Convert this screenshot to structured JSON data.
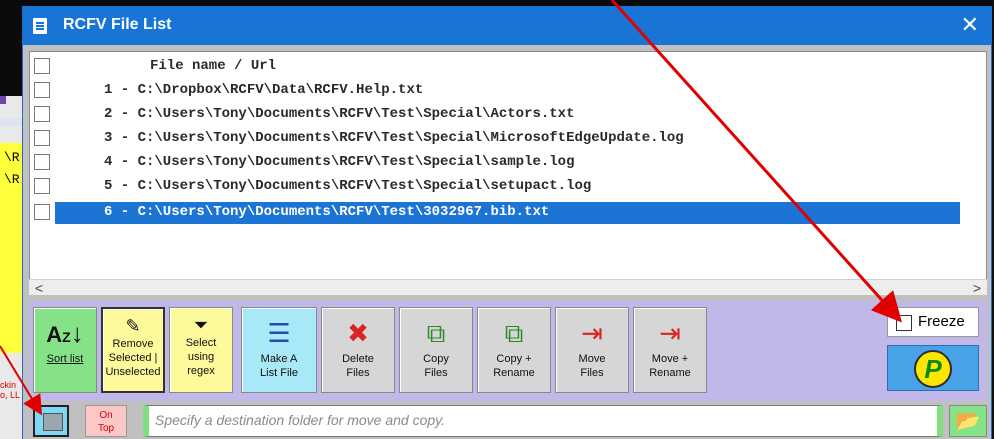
{
  "window": {
    "title": "RCFV File List",
    "close_glyph": "✕"
  },
  "background": {
    "yellow_lines": [
      "\\R",
      "\\R"
    ],
    "red_lines": [
      "ckin",
      "o, LL"
    ]
  },
  "list": {
    "header": "File name / Url",
    "rows": [
      {
        "text": "1 - C:\\Dropbox\\RCFV\\Data\\RCFV.Help.txt",
        "selected": false
      },
      {
        "text": "2 - C:\\Users\\Tony\\Documents\\RCFV\\Test\\Special\\Actors.txt",
        "selected": false
      },
      {
        "text": "3 - C:\\Users\\Tony\\Documents\\RCFV\\Test\\Special\\MicrosoftEdgeUpdate.log",
        "selected": false
      },
      {
        "text": "4 - C:\\Users\\Tony\\Documents\\RCFV\\Test\\Special\\sample.log",
        "selected": false
      },
      {
        "text": "5 - C:\\Users\\Tony\\Documents\\RCFV\\Test\\Special\\setupact.log",
        "selected": false
      },
      {
        "text": "6 - C:\\Users\\Tony\\Documents\\RCFV\\Test\\3032967.bib.txt",
        "selected": true
      }
    ],
    "scroll_left": "<",
    "scroll_right": ">"
  },
  "toolbar": {
    "sort": {
      "label": "Sort list",
      "icon": "sort-az-icon"
    },
    "remove": {
      "line1": "Remove",
      "line2": "Selected |",
      "line3": "Unselected",
      "icon": "eraser-icon"
    },
    "select": {
      "line1": "Select",
      "line2": "using",
      "line3": "regex",
      "icon": "funnel-icon"
    },
    "makelist": {
      "line1": "Make A",
      "line2": "List File",
      "icon": "list-file-icon"
    },
    "delete": {
      "line1": "Delete",
      "line2": "Files",
      "icon": "delete-files-icon"
    },
    "copy": {
      "line1": "Copy",
      "line2": "Files",
      "icon": "copy-files-icon"
    },
    "copyrename": {
      "line1": "Copy +",
      "line2": "Rename",
      "icon": "copy-rename-icon"
    },
    "move": {
      "line1": "Move",
      "line2": "Files",
      "icon": "move-files-icon"
    },
    "moverename": {
      "line1": "Move +",
      "line2": "Rename",
      "icon": "move-rename-icon"
    },
    "freeze_label": "Freeze",
    "help_glyph": "P"
  },
  "bottom": {
    "ontop_line1": "On",
    "ontop_line2": "Top",
    "destination_placeholder": "Specify a destination folder for move and copy.",
    "folder_icon": "folder-open-icon"
  },
  "colors": {
    "titlebar": "#1875d6",
    "selection": "#1c74d4",
    "toolbar_bg": "#c0b8e8",
    "annotation": "#e00000"
  }
}
